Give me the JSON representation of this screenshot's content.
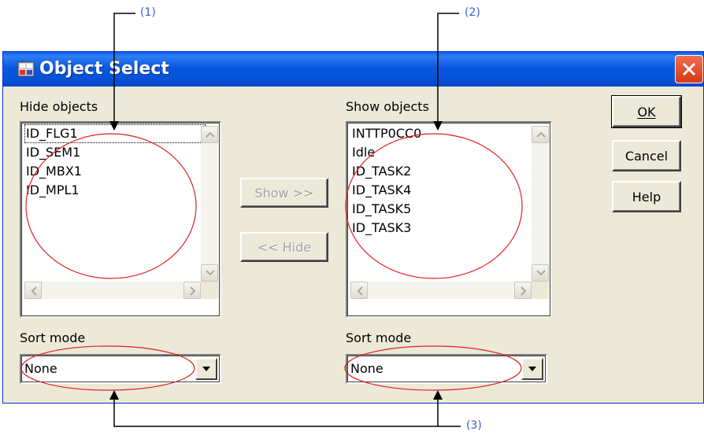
{
  "callouts": {
    "c1": "(1)",
    "c2": "(2)",
    "c3": "(3)"
  },
  "window": {
    "title": "Object Select",
    "app_icon": "object-select-app-icon",
    "close_icon": "close-icon"
  },
  "hide_panel": {
    "label": "Hide objects",
    "items": [
      "ID_FLG1",
      "ID_SEM1",
      "ID_MBX1",
      "ID_MPL1"
    ],
    "sort_label": "Sort mode",
    "sort_value": "None"
  },
  "show_panel": {
    "label": "Show objects",
    "items": [
      "INTTP0CC0",
      "Idle",
      "ID_TASK2",
      "ID_TASK4",
      "ID_TASK5",
      "ID_TASK3"
    ],
    "sort_label": "Sort mode",
    "sort_value": "None"
  },
  "buttons": {
    "show": "Show >>",
    "hide": "<< Hide",
    "ok": "OK",
    "cancel": "Cancel",
    "help": "Help"
  },
  "colors": {
    "annotation": "#3a5fcd",
    "ellipse": "#e02020",
    "titlebar": "#0a58e0"
  }
}
